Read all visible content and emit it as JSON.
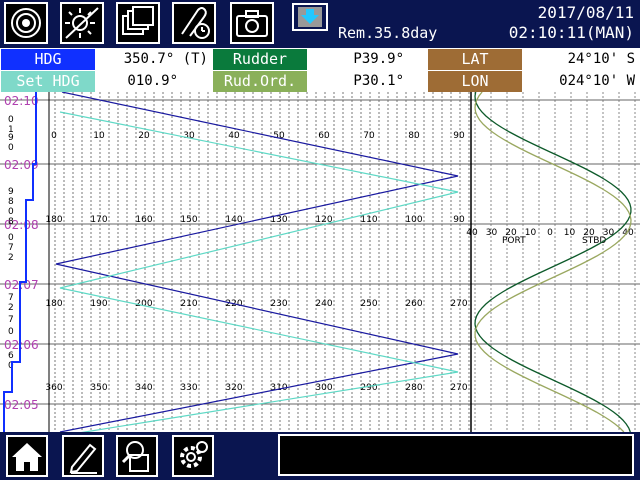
{
  "header": {
    "remaining": "Rem.35.8day",
    "date": "2017/08/11",
    "time": "02:10:11(MAN)",
    "buttons": [
      "settings-dial-icon",
      "brightness-icon",
      "windows-icon",
      "attachment-clock-icon",
      "camera-icon",
      "download-icon"
    ]
  },
  "info": {
    "hdg_label": "HDG",
    "hdg_value": "350.7° (T)",
    "rudder_label": "Rudder",
    "rudder_value": "P39.9°",
    "lat_label": "LAT",
    "lat_value": "24°10' S",
    "sethdg_label": "Set HDG",
    "sethdg_value": "010.9°",
    "rudord_label": "Rud.Ord.",
    "rudord_value": "P30.1°",
    "lon_label": "LON",
    "lon_value": "024°10' W"
  },
  "plot": {
    "time_labels": [
      "02:10",
      "02:09",
      "02:08",
      "02:07",
      "02:06",
      "02:05"
    ],
    "scale_0_90": [
      "0",
      "10",
      "20",
      "30",
      "40",
      "50",
      "60",
      "70",
      "80",
      "90"
    ],
    "scale_180_90": [
      "180",
      "170",
      "160",
      "150",
      "140",
      "130",
      "120",
      "110",
      "100",
      "90"
    ],
    "scale_180_270": [
      "180",
      "190",
      "200",
      "210",
      "220",
      "230",
      "240",
      "250",
      "260",
      "270"
    ],
    "scale_360_270": [
      "360",
      "350",
      "340",
      "330",
      "320",
      "310",
      "300",
      "290",
      "280",
      "270"
    ],
    "rudder_scale": [
      "40",
      "30",
      "20",
      "10",
      "0",
      "10",
      "20",
      "30",
      "40"
    ],
    "port_label": "PORT",
    "stbd_label": "STBD",
    "left_digits": [
      "0",
      "1",
      "9",
      "0",
      "9",
      "8",
      "0",
      "8",
      "0",
      "7",
      "2",
      "7",
      "2",
      "7",
      "0",
      "6",
      "0"
    ]
  },
  "bottom": {
    "buttons": [
      "home-icon",
      "pencil-icon",
      "search-doc-icon",
      "gear-settings-icon"
    ],
    "message": ""
  },
  "colors": {
    "topbar": "#0a1550",
    "hdg": "#1030ff",
    "sethdg": "#7fd9c9",
    "rudder": "#0a7a3c",
    "rudord": "#8ab05a",
    "lat": "#9e6c35",
    "heading_line": "#1a1aa0",
    "set_heading_line": "#5fd9c6",
    "rudder_line": "#0d5a2a",
    "rudder_order_line": "#9aa860"
  }
}
